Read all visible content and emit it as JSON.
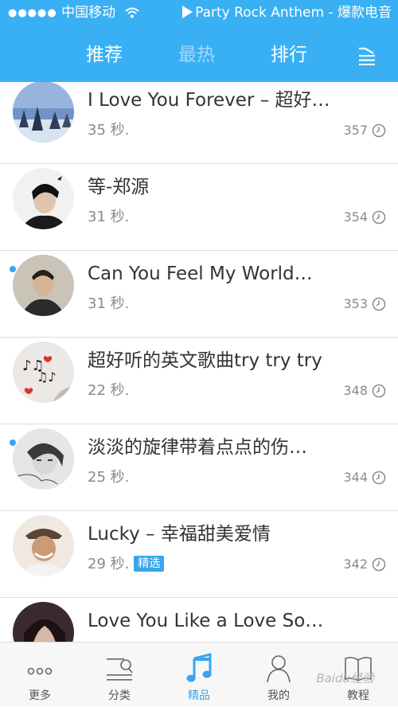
{
  "status": {
    "carrier": "中国移动",
    "now_playing": "Party Rock Anthem - 爆款电音"
  },
  "tabs": [
    {
      "label": "推荐",
      "active": true
    },
    {
      "label": "最热",
      "active": false
    },
    {
      "label": "排行",
      "active": true
    }
  ],
  "songs": [
    {
      "title": "I Love You Forever – 超好…",
      "duration": "35 秒.",
      "plays": "357",
      "unread": false,
      "badge": ""
    },
    {
      "title": "等-郑源",
      "duration": "31 秒.",
      "plays": "354",
      "unread": false,
      "badge": ""
    },
    {
      "title": "Can You Feel My World…",
      "duration": "31 秒.",
      "plays": "353",
      "unread": true,
      "badge": ""
    },
    {
      "title": "超好听的英文歌曲try try try",
      "duration": "22 秒.",
      "plays": "348",
      "unread": false,
      "badge": ""
    },
    {
      "title": "淡淡的旋律带着点点的伤…",
      "duration": "25 秒.",
      "plays": "344",
      "unread": true,
      "badge": ""
    },
    {
      "title": "Lucky – 幸福甜美爱情",
      "duration": "29 秒.",
      "plays": "342",
      "unread": false,
      "badge": "精选"
    },
    {
      "title": "Love You Like a Love So…",
      "duration": "",
      "plays": "",
      "unread": false,
      "badge": ""
    }
  ],
  "tabbar": [
    {
      "label": "更多",
      "icon": "more-dots-icon"
    },
    {
      "label": "分类",
      "icon": "category-search-icon"
    },
    {
      "label": "精品",
      "icon": "music-note-icon",
      "active": true
    },
    {
      "label": "我的",
      "icon": "person-icon"
    },
    {
      "label": "教程",
      "icon": "book-icon"
    }
  ],
  "watermark": "Baidu经验",
  "colors": {
    "header": "#39b0f4",
    "accent": "#37a6ea",
    "text": "#333333",
    "muted": "#8a8a8a"
  }
}
